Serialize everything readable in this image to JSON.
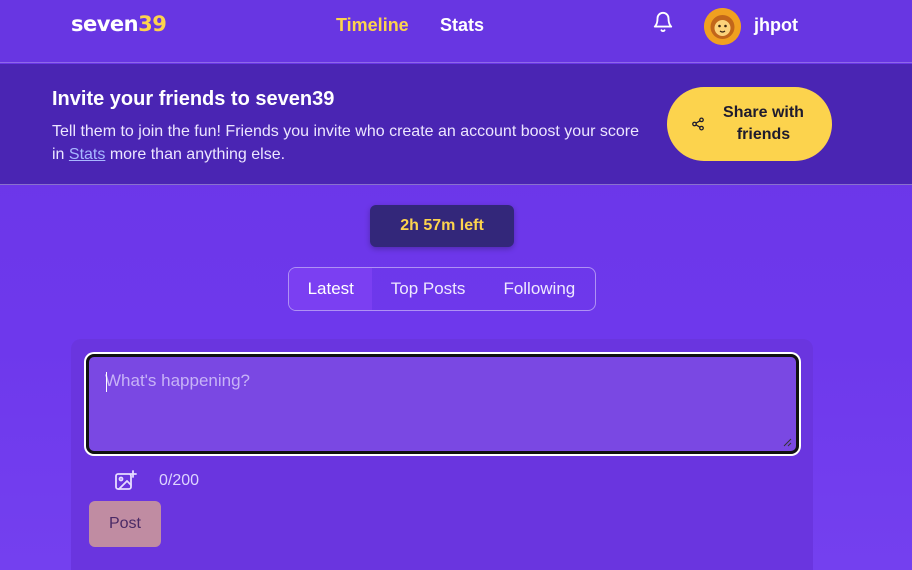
{
  "nav": {
    "logo_text": "seven",
    "logo_num": "39",
    "links": [
      "Timeline",
      "Stats"
    ],
    "username": "jhpot",
    "icons": {
      "notifications": "bell-icon",
      "avatar": "lion-avatar"
    }
  },
  "invite": {
    "title": "Invite your friends to seven39",
    "text_before": "Tell them to join the fun! Friends you invite who create an account boost your score in ",
    "link_text": "Stats",
    "text_after": " more than anything else.",
    "share_label": "Share with friends",
    "share_icon": "share-icon"
  },
  "timer": {
    "label": "2h 57m left"
  },
  "tabs": [
    "Latest",
    "Top Posts",
    "Following"
  ],
  "composer": {
    "placeholder": "What's happening?",
    "counter": "0/200",
    "post_label": "Post",
    "image_icon": "image-add-icon"
  },
  "colors": {
    "accent": "#fcd34d",
    "background": "#6a35e6",
    "banner": "#4a25b3"
  }
}
